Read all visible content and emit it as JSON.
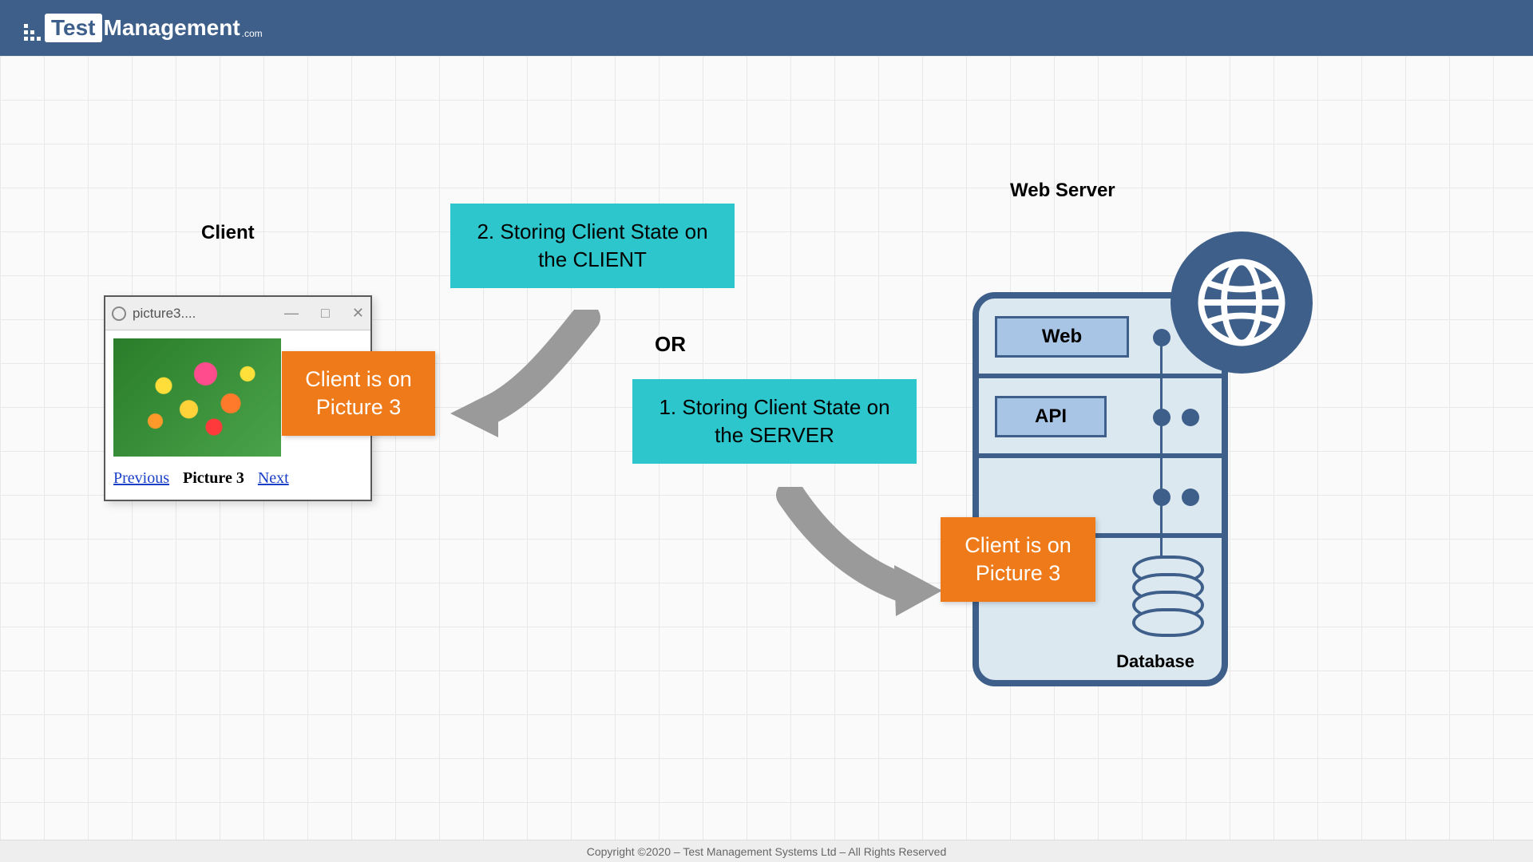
{
  "brand": {
    "test": "Test",
    "mgmt": "Management",
    "com": ".com"
  },
  "labels": {
    "client": "Client",
    "web_server": "Web Server",
    "or": "OR"
  },
  "browser": {
    "tab_title": "picture3....",
    "nav": {
      "prev": "Previous",
      "current": "Picture 3",
      "next": "Next"
    }
  },
  "callouts": {
    "store_client": "2. Storing Client State on the CLIENT",
    "store_server": "1. Storing Client State on the SERVER"
  },
  "state_boxes": {
    "client_state": "Client is on Picture 3",
    "server_state": "Client is on Picture 3"
  },
  "server": {
    "modules": {
      "web": "Web",
      "api": "API"
    },
    "database_label": "Database"
  },
  "footer": "Copyright ©2020 – Test Management Systems Ltd – All Rights Reserved"
}
